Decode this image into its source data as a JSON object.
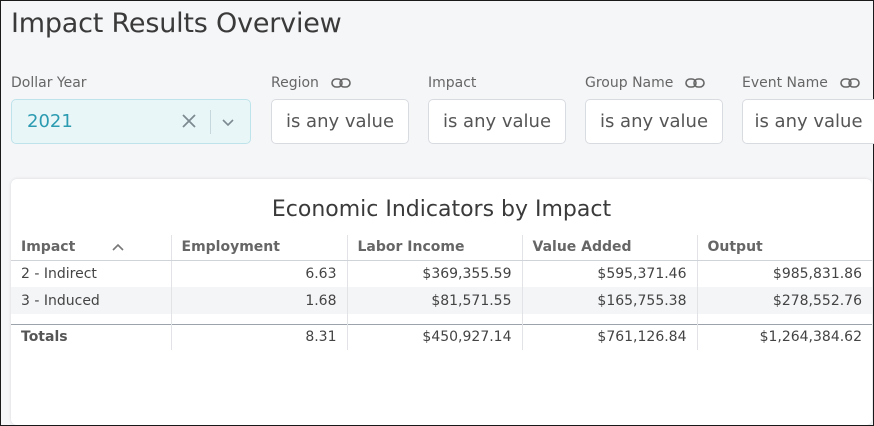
{
  "page": {
    "title": "Impact Results Overview"
  },
  "filters": {
    "dollar_year": {
      "label": "Dollar Year",
      "value": "2021"
    },
    "region": {
      "label": "Region",
      "value": "is any value"
    },
    "impact": {
      "label": "Impact",
      "value": "is any value"
    },
    "group_name": {
      "label": "Group Name",
      "value": "is any value"
    },
    "event_name": {
      "label": "Event Name",
      "value": "is any value"
    }
  },
  "table": {
    "title": "Economic Indicators by Impact",
    "columns": [
      "Impact",
      "Employment",
      "Labor Income",
      "Value Added",
      "Output"
    ],
    "rows": [
      [
        "2 - Indirect",
        "6.63",
        "$369,355.59",
        "$595,371.46",
        "$985,831.86"
      ],
      [
        "3 - Induced",
        "1.68",
        "$81,571.55",
        "$165,755.38",
        "$278,552.76"
      ]
    ],
    "totals": [
      "Totals",
      "8.31",
      "$450,927.14",
      "$761,126.84",
      "$1,264,384.62"
    ]
  },
  "icons": {
    "link": "link-icon",
    "clear": "close-icon",
    "dropdown": "chevron-down-icon",
    "sort": "chevron-up-icon"
  },
  "colors": {
    "selected_bg": "#e9f6f8",
    "selected_text": "#2a9bb0"
  }
}
